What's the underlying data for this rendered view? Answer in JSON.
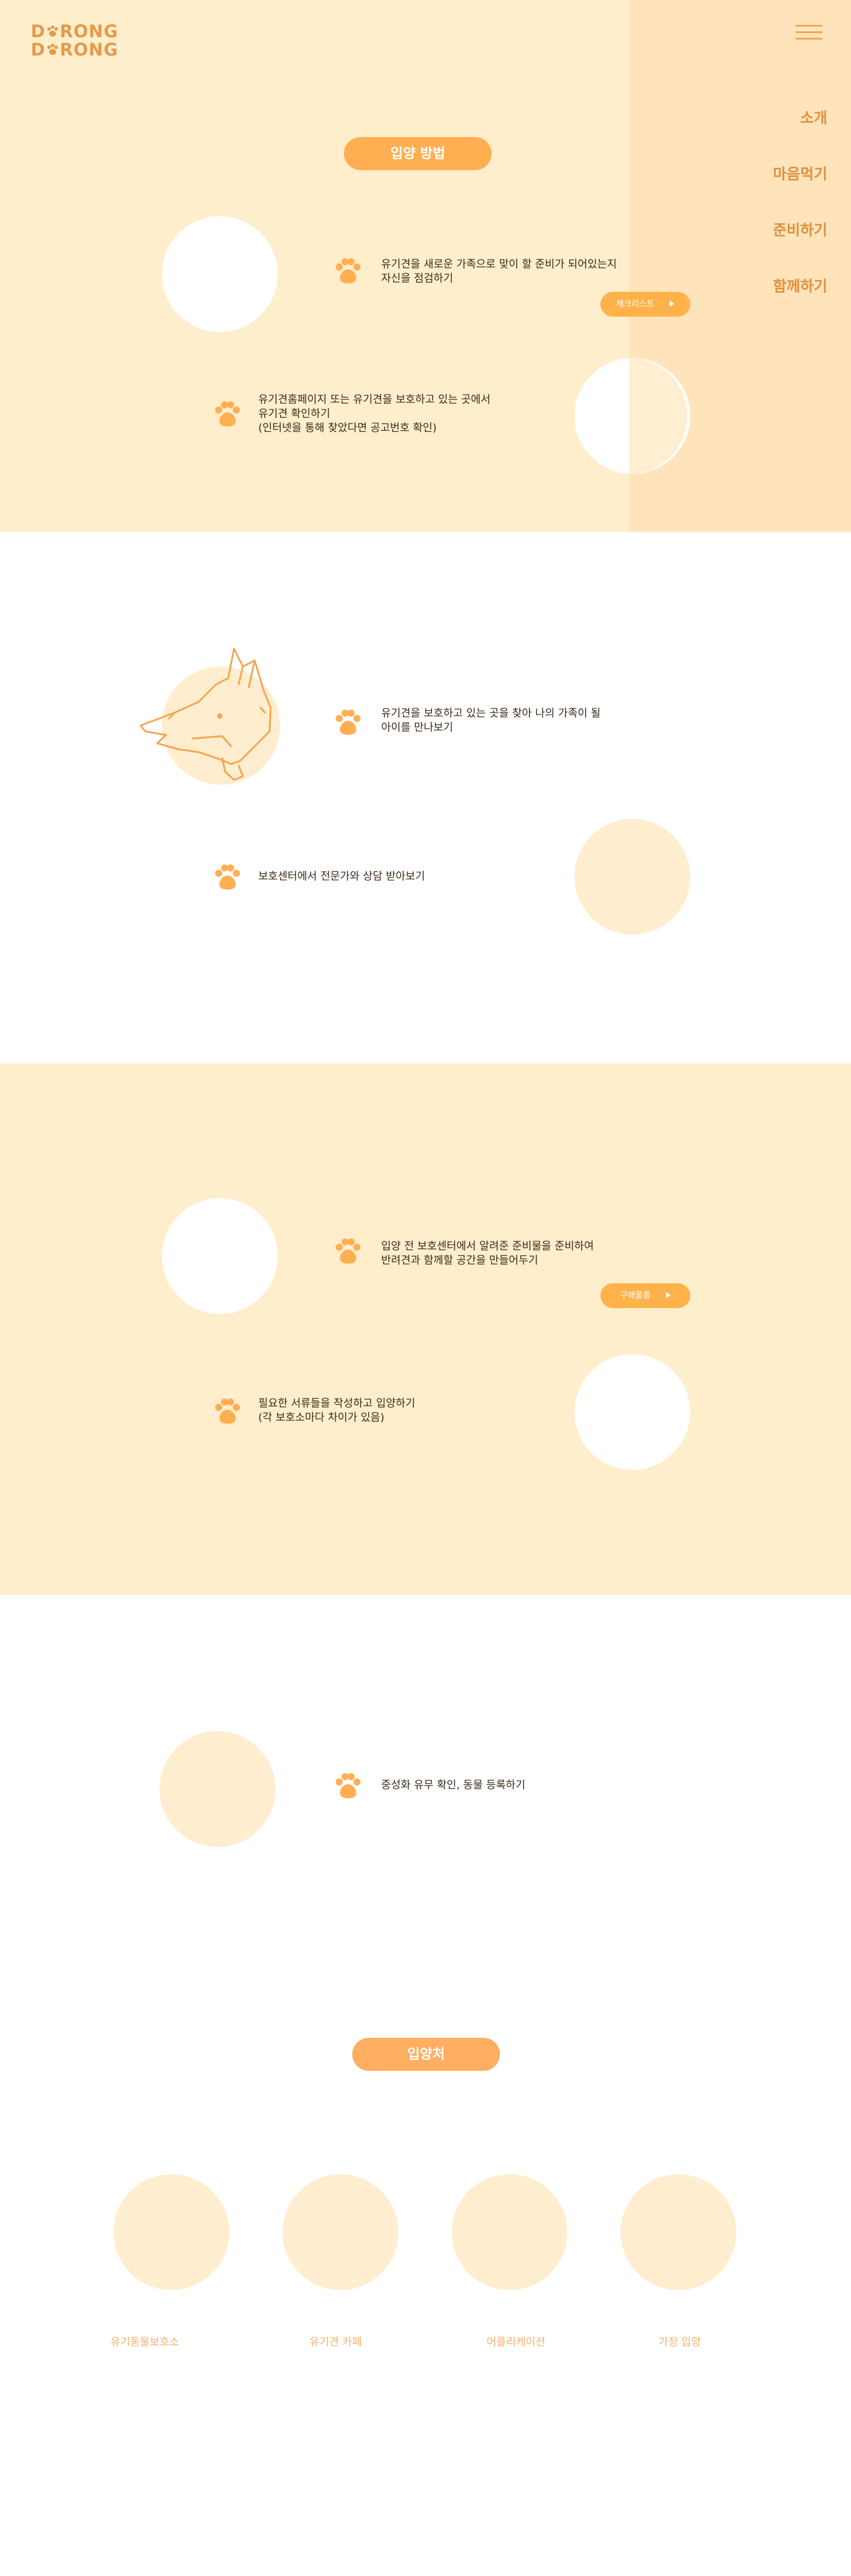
{
  "logo": {
    "line1_a": "D",
    "line1_b": "RONG",
    "line2_a": "D",
    "line2_b": "RONG"
  },
  "nav": {
    "items": [
      "소개",
      "마음먹기",
      "준비하기",
      "함께하기"
    ]
  },
  "section_title": "입양 방법",
  "steps": [
    {
      "text_lines": [
        "유기견을 새로운 가족으로 맞이 할 준비가 되어있는지",
        "자신을 점검하기"
      ]
    },
    {
      "text_lines": [
        "유기견홈페이지 또는 유기견을 보호하고 있는 곳에서",
        "유기견 확인하기",
        "(인터넷을 통해 찾았다면 공고번호 확인)"
      ]
    },
    {
      "text_lines": [
        "유기견을 보호하고 있는 곳을 찾아 나의 가족이 될",
        "아이를 만나보기"
      ]
    },
    {
      "text_lines": [
        "보호센터에서 전문가와 상담 받아보기"
      ]
    },
    {
      "text_lines": [
        "입양 전 보호센터에서 알려준 준비물을 준비하여",
        "반려견과 함께할 공간을 만들어두기"
      ]
    },
    {
      "text_lines": [
        "필요한 서류들을 작성하고 입양하기",
        "(각 보호소마다 차이가 있음)"
      ]
    },
    {
      "text_lines": [
        "중성화 유무 확인, 동물 등록하기"
      ]
    }
  ],
  "buttons": {
    "checklist": "체크리스트",
    "supplies": "구매물품"
  },
  "adoption_title": "입양처",
  "places": [
    "유기동물보호소",
    "유기견 카페",
    "어플리케이션",
    "가정 입양"
  ],
  "colors": {
    "accent": "#ffaf52",
    "bg_light": "#feeecc",
    "panel": "#ffe4bb",
    "nav_text": "#e0903c",
    "place_circle": "#ffedcf"
  },
  "icons": {
    "step": "paw-icon",
    "menu": "hamburger-icon",
    "button_arrow": "play-icon",
    "illustration": "dog-head-icon"
  }
}
